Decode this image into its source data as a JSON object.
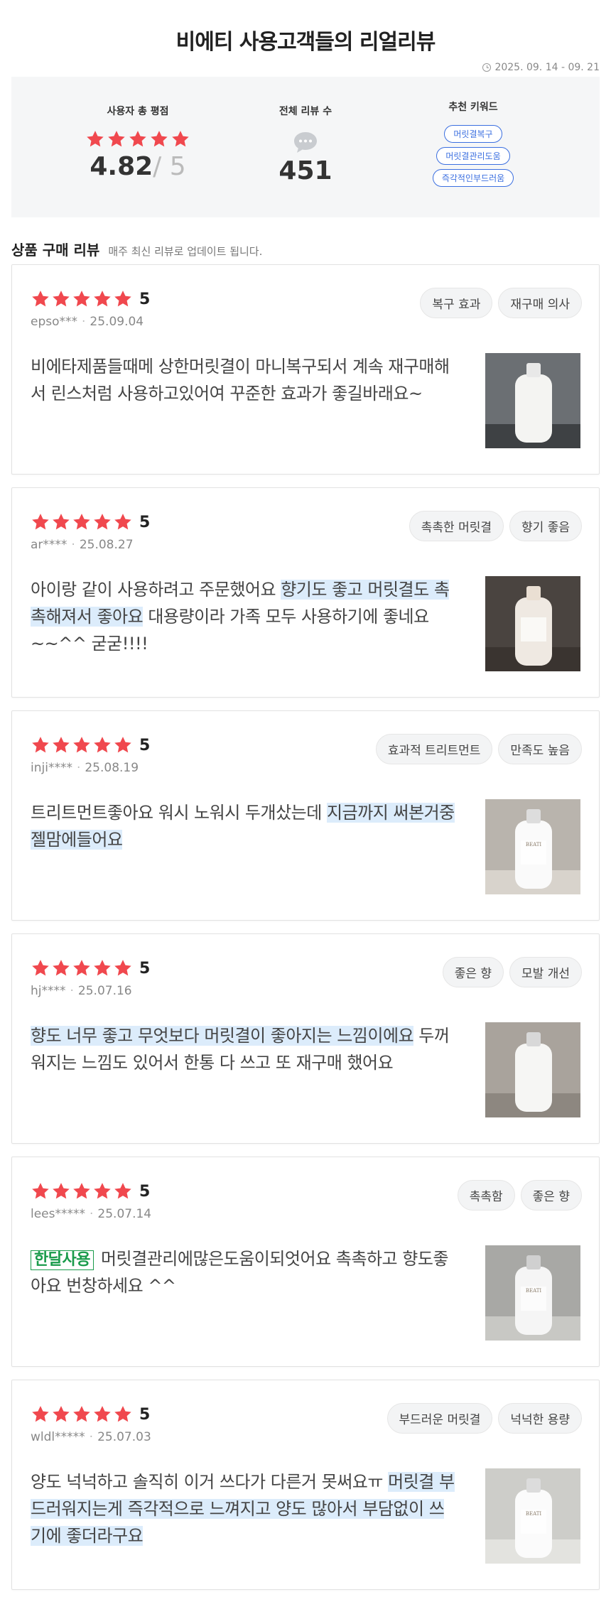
{
  "header": {
    "title": "비에티 사용고객들의 리얼리뷰",
    "period": "2025. 09. 14 - 09. 21"
  },
  "summary": {
    "rating_label": "사용자 총 평점",
    "rating_value": "4.82",
    "rating_max": "5",
    "rating_out": "/ 5",
    "count_label": "전체 리뷰 수",
    "count_value": "451",
    "keywords_label": "추천 키워드",
    "keywords": [
      "머릿결복구",
      "머릿결관리도움",
      "즉각적인부드러움"
    ],
    "star_color": "#f0484e",
    "keyword_color": "#3b6fe0"
  },
  "section": {
    "title": "상품 구매 리뷰",
    "subtitle": "매주 최신 리뷰로 업데이트 됩니다."
  },
  "reviews": [
    {
      "rating": "5",
      "user": "epso***",
      "date": "25.09.04",
      "tags": [
        "복구 효과",
        "재구매 의사"
      ],
      "badge": "",
      "text_plain_before": "비에타제품들때메 상한머릿결이 마니복구되서 계속 재구매해서 린스처럼 사용하고있어여 꾸준한 효과가 좋길바래요~",
      "text_highlight": "",
      "text_plain_after": ""
    },
    {
      "rating": "5",
      "user": "ar****",
      "date": "25.08.27",
      "tags": [
        "촉촉한 머릿결",
        "향기 좋음"
      ],
      "badge": "",
      "text_plain_before": "아이랑 같이 사용하려고 주문했어요 ",
      "text_highlight": "향기도 좋고 머릿결도 촉촉해져서 좋아요",
      "text_plain_after": " 대용량이라 가족 모두 사용하기에 좋네요~~^^ 굳굳!!!!"
    },
    {
      "rating": "5",
      "user": "inji****",
      "date": "25.08.19",
      "tags": [
        "효과적 트리트먼트",
        "만족도 높음"
      ],
      "badge": "",
      "text_plain_before": "트리트먼트좋아요 워시 노워시 두개샀는데 ",
      "text_highlight": "지금까지 써본거중 젤맘에들어요",
      "text_plain_after": ""
    },
    {
      "rating": "5",
      "user": "hj****",
      "date": "25.07.16",
      "tags": [
        "좋은 향",
        "모발 개선"
      ],
      "badge": "",
      "text_plain_before": "",
      "text_highlight": "향도 너무 좋고 무엇보다 머릿결이 좋아지는 느낌이에요",
      "text_plain_after": " 두꺼워지는 느낌도 있어서 한통 다 쓰고 또 재구매 했어요"
    },
    {
      "rating": "5",
      "user": "lees*****",
      "date": "25.07.14",
      "tags": [
        "촉촉함",
        "좋은 향"
      ],
      "badge": "한달사용",
      "text_plain_before": "머릿결관리에많은도움이되엇어요 촉촉하고 향도좋아요 번창하세요 ^^",
      "text_highlight": "",
      "text_plain_after": ""
    },
    {
      "rating": "5",
      "user": "wldl*****",
      "date": "25.07.03",
      "tags": [
        "부드러운 머릿결",
        "넉넉한 용량"
      ],
      "badge": "",
      "text_plain_before": "양도 넉넉하고 솔직히 이거 쓰다가 다른거 못써요ㅠ ",
      "text_highlight": "머릿결 부드러워지는게 즉각적으로 느껴지고 양도 많아서 부담없이 쓰기에 좋더라구요",
      "text_plain_after": ""
    }
  ],
  "images": [
    "bottle-photo",
    "bottle-photo",
    "bottle-photo",
    "bottle-photo",
    "bottle-photo",
    "bottle-photo"
  ],
  "images_text": [
    "",
    "",
    "BEATI",
    "",
    "BEATI",
    "BEATI"
  ]
}
